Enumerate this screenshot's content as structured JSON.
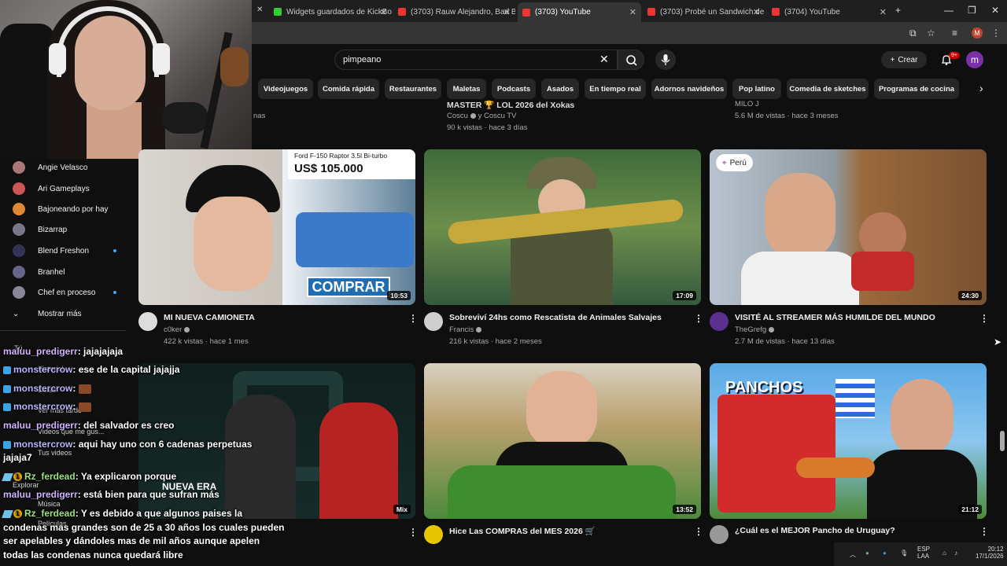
{
  "browser": {
    "tabs": [
      {
        "label": "Widgets guardados de KickBot",
        "fav": "#3c3"
      },
      {
        "label": "(3703) Rauw Alejandro, Bad Bu",
        "fav": "#e33"
      },
      {
        "label": "(3703) YouTube",
        "fav": "#e33",
        "active": true
      },
      {
        "label": "(3703) Probé un Sandwich de l",
        "fav": "#e33"
      },
      {
        "label": "(3704) YouTube",
        "fav": "#e33"
      }
    ],
    "profile_letter": "M"
  },
  "youtube": {
    "search_value": "pimpeano",
    "create_label": "Crear",
    "notif_badge": "9+",
    "avatar_letter": "m",
    "chips": [
      "Videojuegos",
      "Comida rápida",
      "Restaurantes",
      "Maletas",
      "Podcasts",
      "Asados",
      "En tiempo real",
      "Adornos navideños",
      "Pop latino",
      "Comedia de sketches",
      "Programas de cocina"
    ]
  },
  "top_row": {
    "left_partial": "nas",
    "mid_title": "MASTER 🏆 LOL 2026 del Xokas",
    "mid_channel": "Coscu",
    "mid_channel_extra": "y Coscu TV",
    "mid_meta": "90 k vistas · hace 3 días",
    "right_channel": "MILO J",
    "right_meta": "5.6 M de vistas · hace 3 meses"
  },
  "sidebar": {
    "subscriptions": [
      {
        "name": "Angie Velasco",
        "color": "#a77",
        "live": false
      },
      {
        "name": "Ari Gameplays",
        "color": "#c55",
        "live": false
      },
      {
        "name": "Bajoneando por hay",
        "color": "#d83",
        "live": false
      },
      {
        "name": "Bizarrap",
        "color": "#778",
        "live": false
      },
      {
        "name": "Blend Freshon",
        "color": "#335",
        "live": true
      },
      {
        "name": "Branhel",
        "color": "#668",
        "live": false
      },
      {
        "name": "Chef en proceso",
        "color": "#889",
        "live": true
      }
    ],
    "show_more": "Mostrar más",
    "faint_items": [
      "Tú",
      "Historial",
      "Listas",
      "Ver más tarde",
      "Videos que me gus...",
      "Tus videos",
      "Explorar",
      "Música",
      "Películas"
    ]
  },
  "videos": [
    {
      "title": "MI NUEVA CAMIONETA",
      "channel": "c0ker",
      "meta": "422 k vistas · hace 1 mes",
      "duration": "10:53",
      "thumb_top": "Ford F-150 Raptor 3.5l Bi-turbo",
      "thumb_price": "US$ 105.000",
      "thumb_cta": "COMPRAR"
    },
    {
      "title": "Sobreviví 24hs como Rescatista de Animales Salvajes",
      "channel": "Francis",
      "meta": "216 k vistas · hace 2 meses",
      "duration": "17:09"
    },
    {
      "title": "VISITÉ AL STREAMER MÁS HUMILDE DEL MUNDO",
      "channel": "TheGrefg",
      "meta": "2.7 M de vistas · hace 13 días",
      "duration": "24:30",
      "thumb_tag": "Perú"
    },
    {
      "title": "Mix",
      "duration": "Mix",
      "thumb_text": "NUEVA ERA"
    },
    {
      "title": "Hice Las COMPRAS del MES 2026 🛒",
      "duration": "13:52"
    },
    {
      "title": "¿Cuál es el MEJOR Pancho de Uruguay?",
      "duration": "21:12",
      "thumb_text": "PANCHOS"
    }
  ],
  "chat": [
    {
      "user": "maluu_predigerr",
      "msg": "jajajajaja",
      "style": "u2"
    },
    {
      "user": "monstercrow",
      "msg": "ese de la capital jajajja",
      "style": "u1"
    },
    {
      "user": "monstercrow",
      "msg": "",
      "style": "u1",
      "emote": true
    },
    {
      "user": "monstercrow",
      "msg": "",
      "style": "u1",
      "emote": true
    },
    {
      "user": "maluu_predigerr",
      "msg": "del salvador es creo",
      "style": "u2"
    },
    {
      "user": "monstercrow",
      "msg": "aqui hay uno con 6 cadenas perpetuas",
      "style": "u1"
    },
    {
      "user": "",
      "msg": "jajaja7",
      "style": "u1"
    },
    {
      "user": "Rz_ferdead",
      "msg": "Ya explicaron porque",
      "style": "u3"
    },
    {
      "user": "maluu_predigerr",
      "msg": "está bien para que sufran más",
      "style": "u2"
    },
    {
      "user": "Rz_ferdead",
      "msg": "Y es debido a que algunos paises la",
      "style": "u3"
    },
    {
      "user": "",
      "msg": "condenas mas grandes son de 25 a 30 años los cuales pueden",
      "style": "u3"
    },
    {
      "user": "",
      "msg": "ser apelables y dándoles mas de mil años aunque apelen",
      "style": "u3"
    },
    {
      "user": "",
      "msg": "todas las condenas nunca quedará libre",
      "style": "u3"
    }
  ],
  "taskbar": {
    "lang": "ESP",
    "lang2": "LAA",
    "time": "20:12",
    "date": "17/1/2026"
  }
}
